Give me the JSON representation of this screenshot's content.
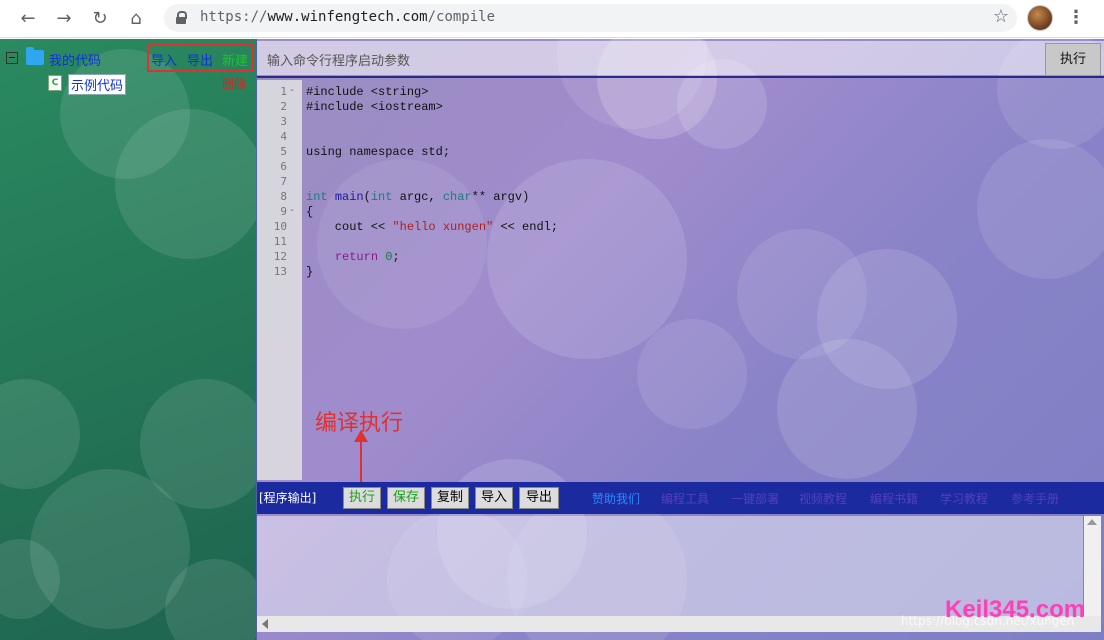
{
  "browser": {
    "url_prefix": "https://",
    "url_host": "www.winfengtech.com",
    "url_path": "/compile"
  },
  "sidebar": {
    "root_label": "我的代码",
    "file_label": "示例代码",
    "import_label": "导入",
    "export_label": "导出",
    "new_label": "新建",
    "delete_label": "删除"
  },
  "args": {
    "placeholder": "输入命令行程序启动参数",
    "run_label": "执行"
  },
  "editor": {
    "lines": [
      "#include <string>",
      "#include <iostream>",
      "",
      "",
      "using namespace std;",
      "",
      "",
      "int main(int argc, char** argv)",
      "{",
      "    cout << \"hello xungen\" << endl;",
      "",
      "    return 0;",
      "}"
    ]
  },
  "annotation": {
    "text": "编译执行"
  },
  "toolbar": {
    "output_label": "[程序输出]",
    "run": "执行",
    "save": "保存",
    "copy": "复制",
    "import": "导入",
    "export": "导出",
    "links": [
      "赞助我们",
      "编程工具",
      "一键部署",
      "视频教程",
      "编程书籍",
      "学习教程",
      "参考手册"
    ]
  },
  "footer": {
    "watermark": "https://blog.csdn.net/xungen",
    "brand": "Keil345.com"
  }
}
